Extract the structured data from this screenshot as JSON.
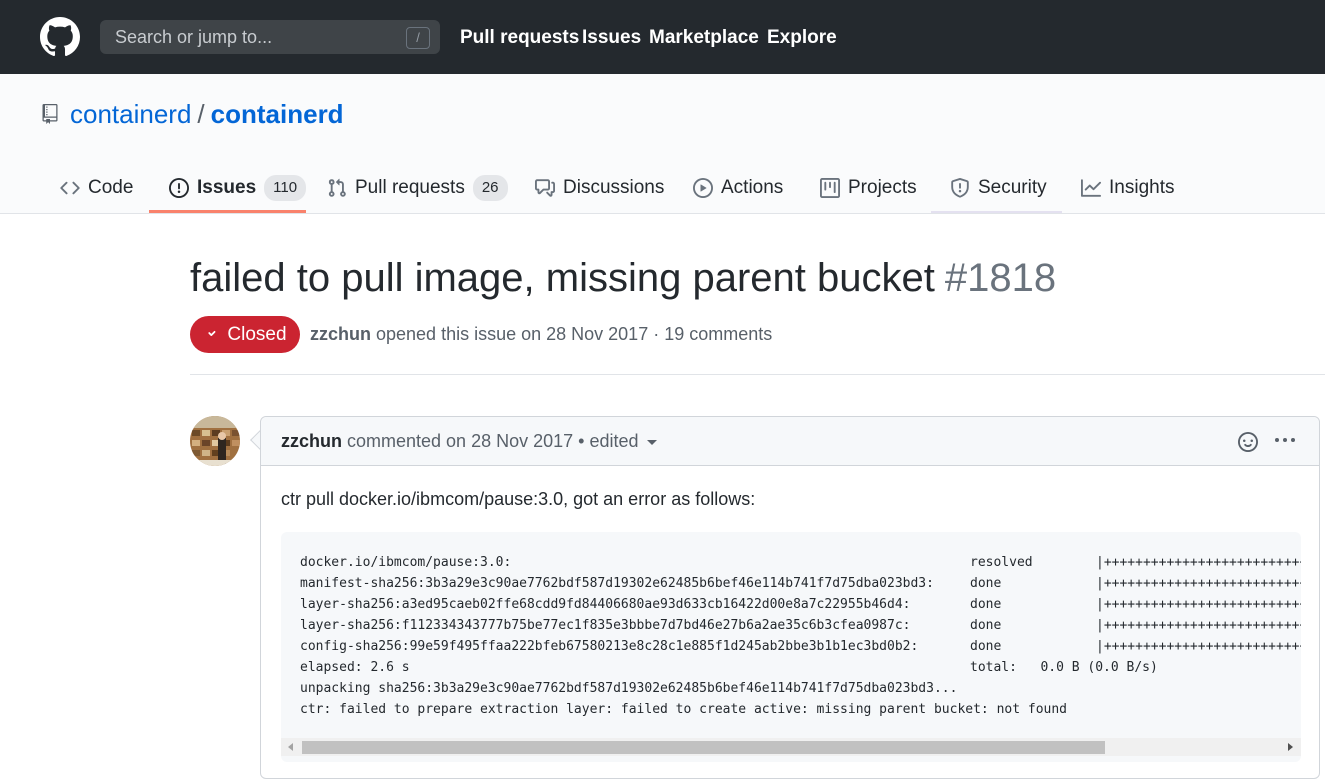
{
  "header": {
    "search_placeholder": "Search or jump to...",
    "search_shortcut": "/",
    "nav": [
      "Pull requests",
      "Issues",
      "Marketplace",
      "Explore"
    ]
  },
  "repo": {
    "owner": "containerd",
    "separator": "/",
    "name": "containerd"
  },
  "tabs": [
    {
      "label": "Code",
      "icon": "code-icon"
    },
    {
      "label": "Issues",
      "count": "110",
      "icon": "issue-opened-icon",
      "selected": true
    },
    {
      "label": "Pull requests",
      "count": "26",
      "icon": "git-pull-request-icon"
    },
    {
      "label": "Discussions",
      "icon": "comment-discussion-icon"
    },
    {
      "label": "Actions",
      "icon": "play-icon"
    },
    {
      "label": "Projects",
      "icon": "project-icon"
    },
    {
      "label": "Security",
      "icon": "shield-icon"
    },
    {
      "label": "Insights",
      "icon": "graph-icon"
    }
  ],
  "issue": {
    "title": "failed to pull image, missing parent bucket",
    "number": "#1818",
    "state": "Closed",
    "author": "zzchun",
    "meta_text": " opened this issue on 28 Nov 2017 · 19 comments"
  },
  "comment": {
    "author": "zzchun",
    "meta_text": " commented on 28 Nov 2017 • edited",
    "body_text": "ctr pull docker.io/ibmcom/pause:3.0, got an error as follows:",
    "code_lines": [
      {
        "left": "docker.io/ibmcom/pause:3.0:",
        "status": "resolved",
        "bar": "|++++++++++++++++++++++++++++++++++++++|"
      },
      {
        "left": "manifest-sha256:3b3a29e3c90ae7762bdf587d19302e62485b6bef46e114b741f7d75dba023bd3:",
        "status": "done",
        "bar": "|++++++++++++++++++++++++++++++++++++++|"
      },
      {
        "left": "layer-sha256:a3ed95caeb02ffe68cdd9fd84406680ae93d633cb16422d00e8a7c22955b46d4:",
        "status": "done",
        "bar": "|++++++++++++++++++++++++++++++++++++++|"
      },
      {
        "left": "layer-sha256:f112334343777b75be77ec1f835e3bbbe7d7bd46e27b6a2ae35c6b3cfea0987c:",
        "status": "done",
        "bar": "|++++++++++++++++++++++++++++++++++++++|"
      },
      {
        "left": "config-sha256:99e59f495ffaa222bfeb67580213e8c28c1e885f1d245ab2bbe3b1b1ec3bd0b2:",
        "status": "done",
        "bar": "|++++++++++++++++++++++++++++++++++++++|"
      },
      {
        "left": "elapsed: 2.6 s",
        "status": "total:   0.0 B (0.0 B/s)",
        "bar": ""
      },
      {
        "left": "unpacking sha256:3b3a29e3c90ae7762bdf587d19302e62485b6bef46e114b741f7d75dba023bd3...",
        "status": "",
        "bar": ""
      },
      {
        "left": "ctr: failed to prepare extraction layer: failed to create active: missing parent bucket: not found",
        "status": "",
        "bar": ""
      }
    ]
  },
  "colors": {
    "header_bg": "#24292e",
    "link": "#0366d6",
    "closed_badge": "#cb2431",
    "tab_underline": "#f9826c"
  }
}
